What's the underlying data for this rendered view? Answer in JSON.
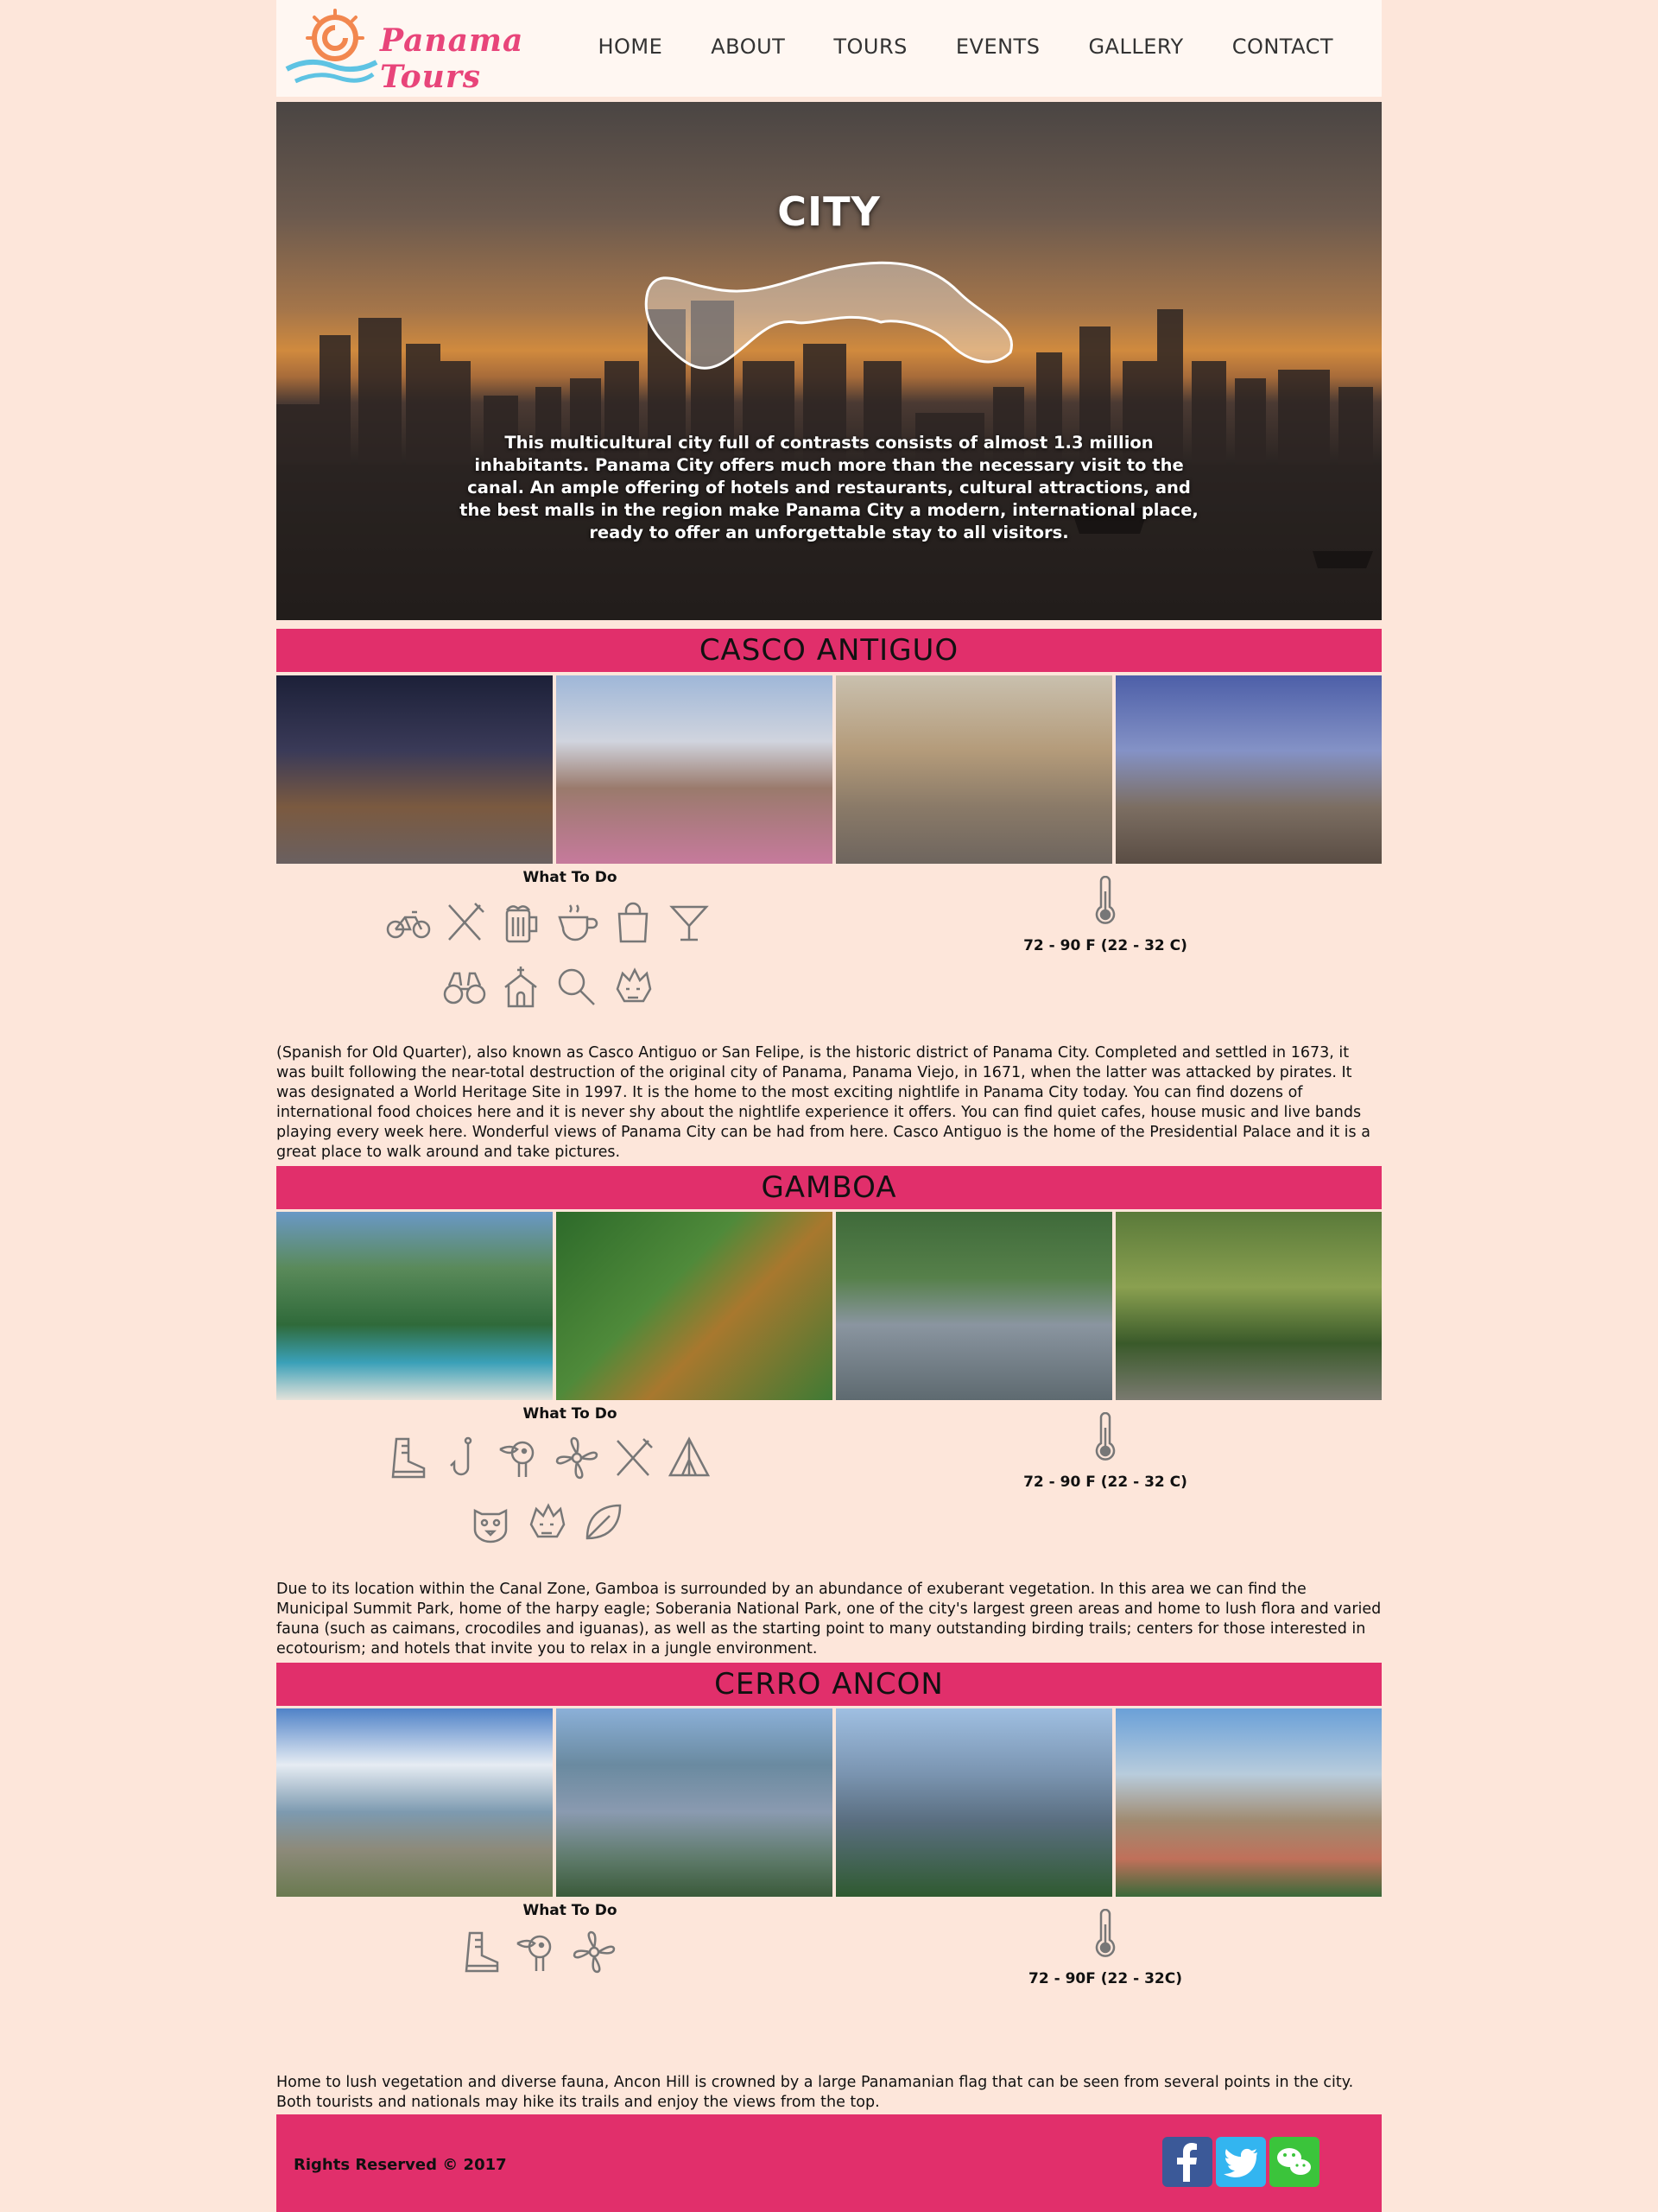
{
  "header": {
    "logo_text": "Panama Tours",
    "nav": [
      "HOME",
      "ABOUT",
      "TOURS",
      "EVENTS",
      "GALLERY",
      "CONTACT"
    ]
  },
  "hero": {
    "title": "CITY",
    "text": "This multicultural city full of contrasts consists of almost 1.3 million inhabitants. Panama City offers much more than the necessary visit to the canal. An ample offering of hotels and restaurants, cultural attractions, and the best malls in the region make Panama City a modern, international place, ready to offer an unforgettable stay to all visitors."
  },
  "sections": [
    {
      "title": "CASCO ANTIGUO",
      "what_to_do": "What To Do",
      "icons": [
        "bicycle-icon",
        "fork-knife-icon",
        "beer-mug-icon",
        "coffee-cup-icon",
        "shopping-bag-icon",
        "cocktail-glass-icon",
        "binoculars-icon",
        "church-icon",
        "magnifier-icon",
        "dragon-mask-icon"
      ],
      "temperature": "72 - 90 F (22 - 32 C)",
      "description": "(Spanish for Old Quarter), also known as Casco Antiguo or San Felipe, is the historic district of Panama City. Completed and settled in 1673, it was built following the near-total destruction of the original city of Panama, Panama Viejo, in 1671, when the latter was attacked by pirates. It was designated a World Heritage Site in 1997. It is the home to the most exciting nightlife in Panama City today. You can find dozens of international food choices here and it is never shy about the nightlife experience it offers. You can find quiet cafes, house music and live bands playing every week here. Wonderful views of Panama City can be had from here. Casco Antiguo is the home of the Presidential Palace and it is a great place to walk around and take pictures."
    },
    {
      "title": "GAMBOA",
      "what_to_do": "What To Do",
      "icons": [
        "hiking-boot-icon",
        "fish-hook-icon",
        "toucan-icon",
        "orchid-flower-icon",
        "fork-knife-icon",
        "tent-icon",
        "jaguar-icon",
        "dragon-mask-icon",
        "leaf-icon"
      ],
      "temperature": "72 - 90 F (22 - 32 C)",
      "description": "Due to its location within the Canal Zone, Gamboa is surrounded by an abundance of exuberant vegetation. In this area we can find the Municipal Summit Park, home of the harpy eagle; Soberania National Park, one of the city's largest green areas and home to lush flora and varied fauna (such as caimans, crocodiles and iguanas), as well as the starting point to many outstanding birding trails; centers for those interested in ecotourism; and hotels that invite you to relax in a jungle environment."
    },
    {
      "title": "CERRO ANCON",
      "what_to_do": "What To Do",
      "icons": [
        "hiking-boot-icon",
        "toucan-icon",
        "orchid-flower-icon"
      ],
      "temperature": "72 - 90F (22 - 32C)",
      "description": "Home to lush vegetation and diverse fauna, Ancon Hill is crowned by a large Panamanian flag that can be seen from several points in the city. Both tourists and nationals may hike its trails and enjoy the views from the top."
    }
  ],
  "footer": {
    "rights": "Rights Reserved © 2017",
    "social": [
      "facebook-icon",
      "twitter-icon",
      "wechat-icon"
    ]
  },
  "colors": {
    "accent": "#e12f6b",
    "background": "#fde6da",
    "logo": "#e8457a"
  }
}
